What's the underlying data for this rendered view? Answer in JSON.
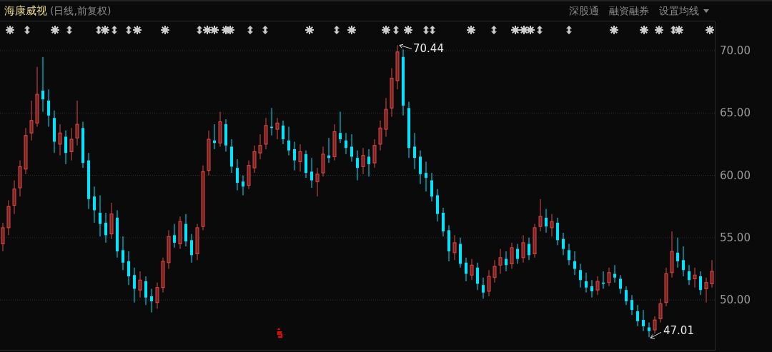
{
  "header": {
    "title": "海康威视",
    "subtitle": "(日线,前复权)",
    "links": [
      {
        "label": "深股通",
        "kind": "link"
      },
      {
        "label": "融资融券",
        "kind": "link"
      },
      {
        "label": "设置均线",
        "kind": "dropdown"
      }
    ]
  },
  "chart_data": {
    "type": "candlestick",
    "ylim": [
      46,
      72.35
    ],
    "grid": true,
    "yticks": [
      {
        "value": 70,
        "label": "70.00"
      },
      {
        "value": 65,
        "label": "65.00"
      },
      {
        "value": 60,
        "label": "60.00"
      },
      {
        "value": 55,
        "label": "55.00"
      },
      {
        "value": 50,
        "label": "50.00"
      }
    ],
    "categories": [
      null,
      null,
      null,
      null,
      null,
      null,
      null,
      null,
      null,
      null,
      null,
      null,
      null,
      null,
      null,
      null,
      null,
      null,
      null,
      null,
      null,
      null,
      null,
      null,
      null,
      null,
      null,
      null,
      null,
      null,
      null,
      null,
      null,
      null,
      null,
      null,
      null,
      null,
      null,
      null,
      null,
      null,
      null,
      null,
      null,
      null,
      null,
      null,
      null,
      null,
      null,
      null,
      null,
      null,
      null,
      null,
      null,
      null,
      null,
      null,
      null,
      null,
      null,
      null,
      null,
      null,
      null,
      null,
      null,
      null,
      null,
      null,
      null,
      null,
      null,
      null,
      null,
      null,
      null,
      null,
      null,
      null,
      null,
      null,
      null,
      null,
      null,
      null,
      null,
      null,
      null,
      null,
      null,
      null,
      null,
      null,
      null,
      null,
      null,
      null,
      null,
      null,
      null,
      null,
      null,
      null,
      null,
      null,
      null,
      null,
      null,
      null,
      null,
      null,
      null,
      null,
      null,
      null,
      null,
      null,
      null,
      null,
      null,
      null,
      null
    ],
    "ohlc": [
      [
        54.5,
        56.2,
        53.9,
        55.8
      ],
      [
        55.8,
        58.0,
        55.2,
        57.5
      ],
      [
        57.6,
        59.6,
        56.9,
        58.9
      ],
      [
        59.0,
        61.2,
        58.3,
        60.7
      ],
      [
        60.5,
        63.8,
        60.1,
        63.2
      ],
      [
        63.4,
        66.0,
        62.8,
        64.4
      ],
      [
        64.2,
        68.7,
        63.9,
        66.5
      ],
      [
        66.8,
        69.5,
        65.1,
        66.1
      ],
      [
        66.0,
        66.9,
        63.9,
        64.8
      ],
      [
        64.6,
        65.2,
        61.8,
        62.7
      ],
      [
        62.5,
        64.1,
        61.6,
        63.4
      ],
      [
        63.1,
        63.6,
        60.9,
        61.8
      ],
      [
        61.9,
        63.8,
        61.2,
        62.9
      ],
      [
        63.0,
        66.0,
        62.4,
        64.1
      ],
      [
        63.8,
        64.3,
        60.6,
        61.0
      ],
      [
        61.2,
        61.8,
        57.3,
        58.1
      ],
      [
        58.3,
        59.1,
        56.2,
        57.2
      ],
      [
        57.0,
        58.4,
        55.1,
        56.1
      ],
      [
        56.2,
        57.0,
        54.6,
        55.2
      ],
      [
        55.3,
        57.8,
        54.9,
        56.9
      ],
      [
        56.6,
        57.2,
        53.4,
        53.9
      ],
      [
        54.0,
        55.1,
        52.4,
        53.0
      ],
      [
        53.1,
        53.9,
        51.2,
        51.9
      ],
      [
        52.0,
        52.6,
        49.8,
        50.9
      ],
      [
        50.8,
        52.3,
        50.2,
        51.6
      ],
      [
        51.5,
        51.9,
        49.6,
        50.2
      ],
      [
        50.3,
        50.9,
        49.0,
        49.9
      ],
      [
        49.8,
        51.4,
        49.3,
        51.0
      ],
      [
        51.0,
        53.4,
        50.6,
        53.1
      ],
      [
        53.0,
        55.6,
        52.5,
        55.1
      ],
      [
        55.2,
        56.1,
        54.2,
        54.6
      ],
      [
        54.5,
        56.7,
        54.1,
        56.3
      ],
      [
        56.1,
        56.9,
        54.3,
        54.7
      ],
      [
        54.8,
        55.3,
        53.0,
        53.6
      ],
      [
        53.7,
        56.1,
        53.2,
        55.8
      ],
      [
        55.9,
        60.8,
        55.6,
        60.3
      ],
      [
        60.4,
        63.6,
        60.0,
        62.9
      ],
      [
        62.8,
        64.1,
        62.1,
        62.6
      ],
      [
        62.6,
        65.1,
        62.3,
        64.3
      ],
      [
        64.1,
        64.5,
        61.9,
        62.4
      ],
      [
        62.3,
        62.9,
        60.2,
        60.7
      ],
      [
        60.6,
        61.3,
        58.8,
        59.4
      ],
      [
        59.5,
        60.0,
        58.4,
        59.1
      ],
      [
        59.2,
        61.2,
        58.9,
        60.8
      ],
      [
        60.6,
        62.4,
        60.2,
        61.9
      ],
      [
        61.8,
        63.3,
        61.3,
        62.4
      ],
      [
        62.5,
        64.6,
        62.1,
        64.0
      ],
      [
        63.9,
        65.4,
        63.2,
        63.8
      ],
      [
        63.7,
        64.6,
        62.9,
        64.2
      ],
      [
        64.0,
        64.4,
        62.5,
        62.9
      ],
      [
        62.8,
        63.9,
        61.6,
        62.0
      ],
      [
        62.1,
        62.7,
        60.4,
        61.2
      ],
      [
        61.1,
        62.5,
        60.3,
        61.9
      ],
      [
        61.7,
        62.0,
        59.8,
        60.2
      ],
      [
        60.3,
        61.4,
        59.0,
        59.6
      ],
      [
        59.5,
        60.6,
        58.3,
        60.1
      ],
      [
        60.2,
        62.3,
        59.9,
        61.7
      ],
      [
        61.6,
        63.0,
        61.0,
        61.4
      ],
      [
        61.5,
        64.1,
        61.2,
        63.5
      ],
      [
        63.4,
        65.1,
        62.6,
        62.9
      ],
      [
        62.8,
        63.4,
        61.7,
        62.2
      ],
      [
        62.3,
        63.3,
        61.1,
        61.5
      ],
      [
        61.4,
        62.0,
        59.6,
        60.6
      ],
      [
        60.7,
        62.2,
        60.1,
        61.6
      ],
      [
        61.5,
        62.1,
        59.9,
        60.9
      ],
      [
        61.0,
        62.9,
        60.6,
        62.4
      ],
      [
        62.5,
        64.4,
        62.0,
        63.8
      ],
      [
        63.7,
        66.2,
        63.1,
        65.3
      ],
      [
        65.4,
        68.6,
        64.7,
        67.8
      ],
      [
        67.6,
        70.44,
        66.9,
        69.9
      ],
      [
        69.5,
        70.1,
        64.8,
        65.6
      ],
      [
        65.4,
        65.9,
        61.4,
        62.2
      ],
      [
        62.3,
        63.4,
        60.5,
        61.4
      ],
      [
        61.5,
        62.0,
        59.3,
        60.1
      ],
      [
        60.2,
        61.1,
        58.7,
        59.8
      ],
      [
        59.6,
        60.2,
        57.9,
        58.3
      ],
      [
        58.4,
        58.9,
        56.3,
        56.9
      ],
      [
        57.0,
        57.4,
        55.1,
        55.5
      ],
      [
        55.6,
        56.0,
        53.1,
        53.9
      ],
      [
        53.8,
        55.2,
        53.2,
        54.6
      ],
      [
        54.5,
        55.0,
        52.6,
        52.9
      ],
      [
        53.0,
        53.4,
        51.5,
        52.1
      ],
      [
        52.0,
        53.3,
        51.6,
        52.8
      ],
      [
        52.6,
        53.0,
        50.8,
        51.3
      ],
      [
        51.2,
        51.8,
        50.1,
        50.6
      ],
      [
        50.7,
        52.4,
        50.3,
        51.9
      ],
      [
        51.8,
        53.2,
        51.4,
        52.7
      ],
      [
        52.8,
        54.1,
        52.1,
        53.4
      ],
      [
        53.3,
        53.9,
        52.3,
        52.8
      ],
      [
        52.9,
        54.6,
        52.5,
        54.2
      ],
      [
        54.1,
        54.5,
        52.9,
        53.3
      ],
      [
        53.4,
        55.2,
        53.0,
        54.6
      ],
      [
        54.5,
        55.0,
        53.2,
        53.6
      ],
      [
        53.7,
        56.1,
        53.4,
        55.8
      ],
      [
        55.9,
        58.1,
        55.5,
        56.7
      ],
      [
        56.6,
        57.3,
        55.4,
        55.9
      ],
      [
        55.8,
        56.9,
        55.1,
        56.3
      ],
      [
        56.2,
        56.6,
        54.4,
        54.8
      ],
      [
        54.9,
        55.4,
        53.6,
        54.1
      ],
      [
        54.0,
        54.5,
        52.8,
        53.2
      ],
      [
        53.1,
        53.9,
        52.0,
        52.5
      ],
      [
        52.4,
        52.9,
        51.0,
        51.6
      ],
      [
        51.5,
        52.2,
        50.6,
        51.0
      ],
      [
        51.1,
        51.6,
        50.2,
        50.7
      ],
      [
        50.8,
        51.9,
        50.4,
        51.5
      ],
      [
        51.4,
        52.3,
        50.9,
        51.3
      ],
      [
        51.4,
        52.6,
        51.1,
        52.2
      ],
      [
        52.1,
        52.8,
        51.4,
        51.8
      ],
      [
        51.7,
        52.0,
        50.5,
        50.9
      ],
      [
        50.8,
        51.1,
        49.6,
        49.9
      ],
      [
        50.0,
        50.4,
        48.8,
        49.2
      ],
      [
        49.1,
        49.6,
        47.9,
        48.3
      ],
      [
        48.4,
        49.2,
        47.5,
        47.9
      ],
      [
        47.8,
        48.2,
        47.01,
        47.5
      ],
      [
        47.6,
        48.7,
        47.3,
        48.4
      ],
      [
        48.5,
        50.1,
        48.2,
        49.7
      ],
      [
        49.8,
        52.6,
        49.5,
        52.1
      ],
      [
        52.2,
        55.5,
        51.8,
        53.9
      ],
      [
        53.8,
        55.0,
        52.6,
        53.1
      ],
      [
        53.2,
        54.3,
        51.9,
        52.4
      ],
      [
        52.3,
        52.8,
        51.2,
        51.6
      ],
      [
        51.7,
        52.6,
        51.0,
        52.0
      ],
      [
        51.9,
        52.3,
        50.4,
        50.8
      ],
      [
        50.9,
        51.8,
        49.8,
        51.4
      ],
      [
        51.3,
        53.2,
        51.0,
        52.3
      ]
    ],
    "annotations": [
      "70.44",
      "47.01"
    ]
  }
}
